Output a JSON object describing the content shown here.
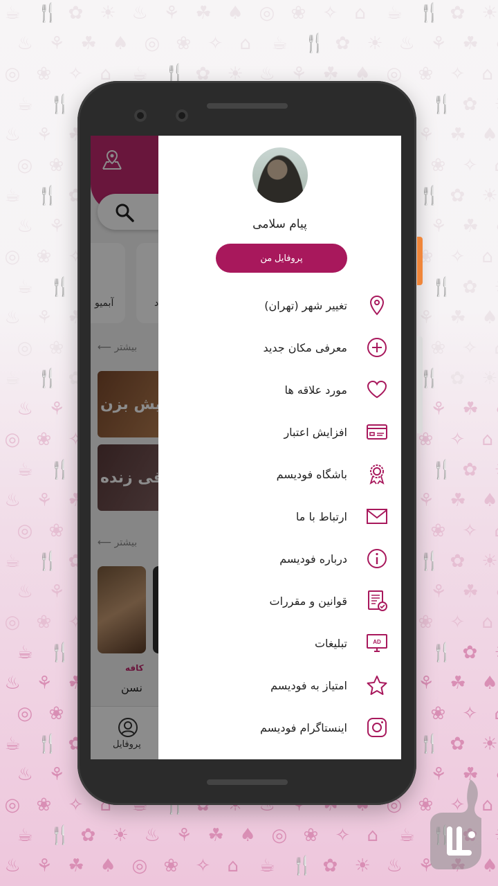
{
  "theme": {
    "accent": "#a8185c",
    "header": "#c0286e"
  },
  "background_app": {
    "categories": [
      {
        "label": "آبمیو"
      },
      {
        "label": "د"
      }
    ],
    "more_label_1": "بیشتر",
    "more_label_2": "بیشتر",
    "feature_1_title": "دیش بزن!",
    "feature_2_title": "قی زنده",
    "place": {
      "category": "کافه",
      "name": "نسن"
    },
    "bottom_nav": {
      "profile_label": "پروفایل"
    }
  },
  "drawer": {
    "user_name": "پیام سلامی",
    "profile_button": "پروفایل من",
    "items": [
      {
        "label": "تغییر شهر (تهران)",
        "icon": "location-pin-icon"
      },
      {
        "label": "معرفی مکان جدید",
        "icon": "plus-circle-icon"
      },
      {
        "label": "مورد علاقه ها",
        "icon": "heart-icon"
      },
      {
        "label": "افزایش اعتبار",
        "icon": "credit-card-icon"
      },
      {
        "label": "باشگاه فودیسم",
        "icon": "badge-icon"
      },
      {
        "label": "ارتباط با ما",
        "icon": "mail-icon"
      },
      {
        "label": "درباره فودیسم",
        "icon": "info-icon"
      },
      {
        "label": "قوانین و مقررات",
        "icon": "document-icon"
      },
      {
        "label": "تبلیغات",
        "icon": "ad-monitor-icon"
      },
      {
        "label": "امتیاز به فودیسم",
        "icon": "star-icon"
      },
      {
        "label": "اینستاگرام فودیسم",
        "icon": "instagram-icon"
      }
    ]
  }
}
